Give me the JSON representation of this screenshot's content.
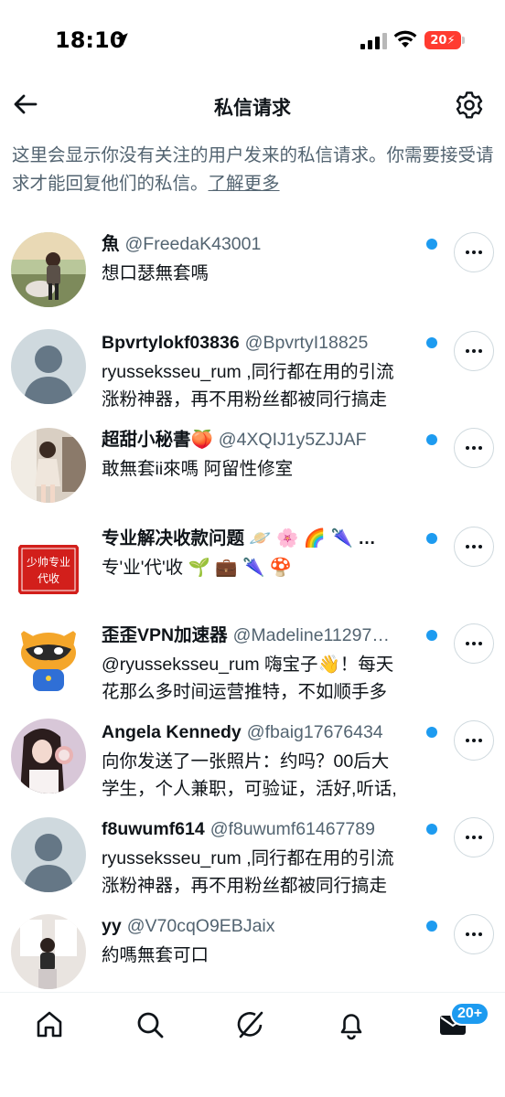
{
  "status_bar": {
    "time": "18:10",
    "battery_text": "20"
  },
  "header": {
    "title": "私信请求"
  },
  "notice": {
    "text": "这里会显示你没有关注的用户发来的私信请求。你需要接受请求才能回复他们的私信。",
    "link_text": "了解更多"
  },
  "messages": [
    {
      "name": "魚",
      "handle": "@FreedaK43001",
      "preview": "想口瑟無套嗎",
      "unread": true,
      "avatar": "photo-avatar"
    },
    {
      "name": "Bpvrtylokf03836",
      "handle": "@BpvrtyI18825",
      "preview": "ryusseksseu_rum ,同行都在用的引流\n涨粉神器，再不用粉丝都被同行搞走",
      "unread": true,
      "avatar": "default-avatar"
    },
    {
      "name": "超甜小秘書🍑",
      "handle": "@4XQIJ1y5ZJJAF",
      "preview": "敢無套ii來嗎 阿留性修室",
      "unread": true,
      "avatar": "photo-avatar"
    },
    {
      "name": "专业解决收款问题 🪐 🌸 🌈 🌂 …",
      "handle": "",
      "preview": "专'业'代'收 🌱 💼 🌂 🍄",
      "unread": true,
      "avatar": "red-seal-avatar",
      "avatar_text": "少帅专业 代收"
    },
    {
      "name": "歪歪VPN加速器",
      "handle": "@Madeline11297…",
      "preview": "@ryusseksseu_rum 嗨宝子👋！每天\n花那么多时间运营推特，不如顺手多",
      "unread": true,
      "avatar": "raccoon-avatar"
    },
    {
      "name": "Angela Kennedy",
      "handle": "@fbaig17676434",
      "preview": "向你发送了一张照片：约吗？00后大\n学生，个人兼职，可验证，活好,听话,",
      "unread": true,
      "avatar": "photo-avatar"
    },
    {
      "name": "f8uwumf614",
      "handle": "@f8uwumf61467789",
      "preview": "ryusseksseu_rum ,同行都在用的引流\n涨粉神器，再不用粉丝都被同行搞走",
      "unread": true,
      "avatar": "default-avatar"
    },
    {
      "name": "yy",
      "handle": "@V70cqO9EBJaix",
      "preview": "約嗎無套可口",
      "unread": true,
      "avatar": "photo-avatar"
    }
  ],
  "bottom_nav": {
    "items": [
      "home-icon",
      "search-icon",
      "grok-icon",
      "notifications-icon",
      "messages-icon"
    ],
    "messages_badge": "20+"
  },
  "colors": {
    "accent": "#1d9bf0",
    "text_primary": "#0f1419",
    "text_secondary": "#536471"
  }
}
